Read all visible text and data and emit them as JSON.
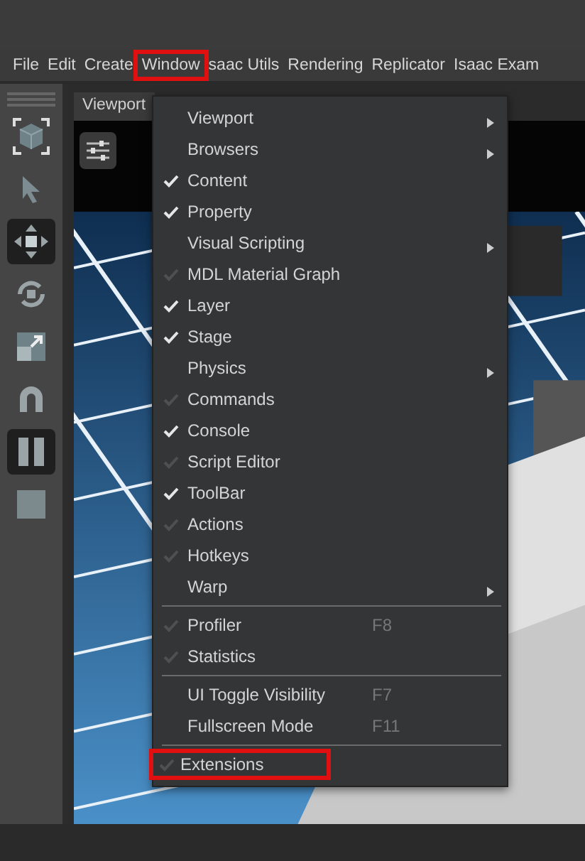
{
  "menubar": [
    {
      "label": "File",
      "highlighted": false
    },
    {
      "label": "Edit",
      "highlighted": false
    },
    {
      "label": "Create",
      "highlighted": false
    },
    {
      "label": "Window",
      "highlighted": true
    },
    {
      "label": "saac Utils",
      "highlighted": false
    },
    {
      "label": "Rendering",
      "highlighted": false
    },
    {
      "label": "Replicator",
      "highlighted": false
    },
    {
      "label": "Isaac Exam",
      "highlighted": false
    }
  ],
  "toolbar": [
    {
      "kind": "select-box",
      "selected": false
    },
    {
      "kind": "pointer",
      "selected": false
    },
    {
      "kind": "move",
      "selected": true
    },
    {
      "kind": "rotate",
      "selected": false
    },
    {
      "kind": "scale",
      "selected": false
    },
    {
      "kind": "snap",
      "selected": false
    },
    {
      "kind": "pause",
      "selected": true
    },
    {
      "kind": "stop",
      "selected": false
    }
  ],
  "viewport": {
    "tab": "Viewport"
  },
  "window_menu": {
    "sections": [
      [
        {
          "kind": "submenu",
          "label": "Viewport"
        },
        {
          "kind": "submenu",
          "label": "Browsers"
        },
        {
          "kind": "toggle",
          "label": "Content",
          "checked": true
        },
        {
          "kind": "toggle",
          "label": "Property",
          "checked": true
        },
        {
          "kind": "submenu",
          "label": "Visual Scripting"
        },
        {
          "kind": "toggle",
          "label": "MDL Material Graph",
          "checked": false
        },
        {
          "kind": "toggle",
          "label": "Layer",
          "checked": true
        },
        {
          "kind": "toggle",
          "label": "Stage",
          "checked": true
        },
        {
          "kind": "submenu",
          "label": "Physics"
        },
        {
          "kind": "toggle",
          "label": "Commands",
          "checked": false
        },
        {
          "kind": "toggle",
          "label": "Console",
          "checked": true
        },
        {
          "kind": "toggle",
          "label": "Script Editor",
          "checked": false
        },
        {
          "kind": "toggle",
          "label": "ToolBar",
          "checked": true
        },
        {
          "kind": "toggle",
          "label": "Actions",
          "checked": false
        },
        {
          "kind": "toggle",
          "label": "Hotkeys",
          "checked": false
        },
        {
          "kind": "submenu",
          "label": "Warp"
        }
      ],
      [
        {
          "kind": "toggle",
          "label": "Profiler",
          "checked": false,
          "shortcut": "F8"
        },
        {
          "kind": "toggle",
          "label": "Statistics",
          "checked": false
        }
      ],
      [
        {
          "kind": "action",
          "label": "UI Toggle Visibility",
          "shortcut": "F7"
        },
        {
          "kind": "action",
          "label": "Fullscreen Mode",
          "shortcut": "F11"
        }
      ],
      [
        {
          "kind": "toggle",
          "label": "Extensions",
          "checked": false,
          "highlighted": true
        }
      ]
    ]
  }
}
